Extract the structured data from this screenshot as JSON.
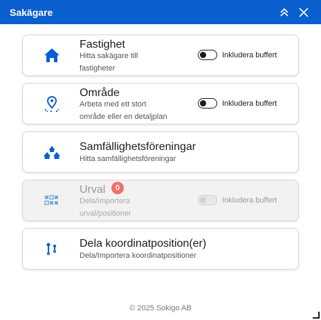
{
  "header": {
    "title": "Sakägare",
    "accent": "#0a5fcf"
  },
  "cards": [
    {
      "title": "Fastighet",
      "subtitle_lines": [
        "Hitta sakägare till",
        "fastigheter"
      ],
      "icon": "house-icon",
      "toggle_label": "Inkludera buffert",
      "toggle_on": false
    },
    {
      "title": "Område",
      "subtitle_lines": [
        "Arbeta med ett stort",
        "område eller en detaljplan"
      ],
      "icon": "area-pin-icon",
      "toggle_label": "Inkludera buffert",
      "toggle_on": false
    },
    {
      "title": "Samfällighetsföreningar",
      "subtitle_lines": [
        "Hitta samfällighetsföreningar"
      ],
      "icon": "houses-group-icon"
    },
    {
      "title": "Urval",
      "badge": "0",
      "subtitle_lines": [
        "Dela/Importera",
        "urval/positioner"
      ],
      "icon": "grid-selection-icon",
      "toggle_label": "Inkludera buffert",
      "toggle_on": false,
      "disabled": true
    },
    {
      "title": "Dela koordinatposition(er)",
      "subtitle_lines": [
        "Dela/Importera koordinatpositioner"
      ],
      "icon": "coordinate-pins-icon"
    }
  ],
  "footer": {
    "text": "© 2025 Sokigo AB"
  }
}
